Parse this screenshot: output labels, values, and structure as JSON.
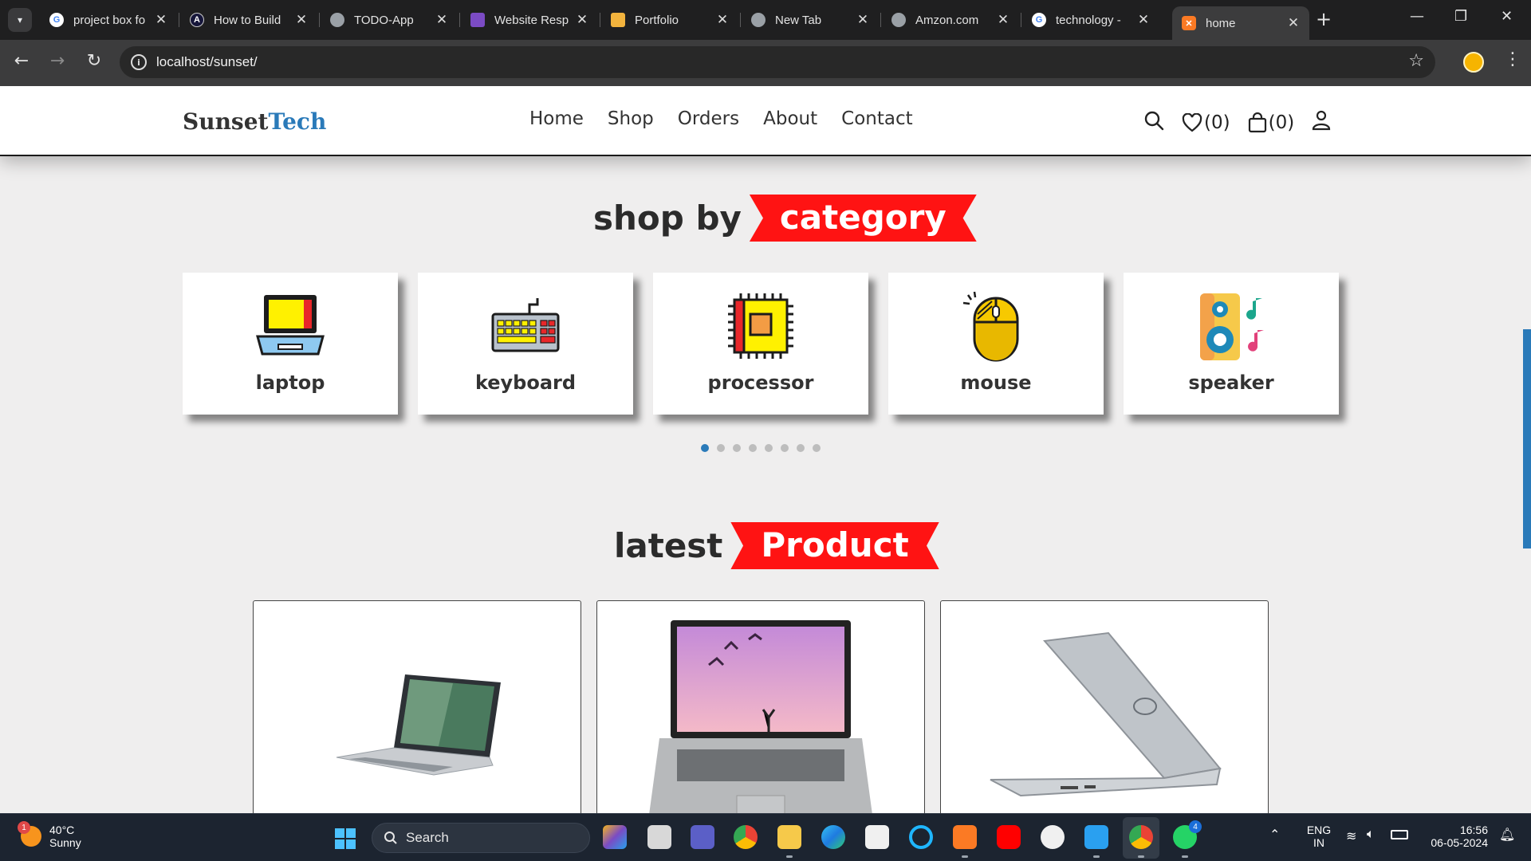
{
  "browser": {
    "tabs": [
      {
        "title": "project box fo",
        "favicon": "google-icon"
      },
      {
        "title": "How to Build",
        "favicon": "app-icon"
      },
      {
        "title": "TODO-App",
        "favicon": "globe-icon"
      },
      {
        "title": "Website Resp",
        "favicon": "website-icon"
      },
      {
        "title": "Portfolio",
        "favicon": "portfolio-icon"
      },
      {
        "title": "New Tab",
        "favicon": "chrome-icon"
      },
      {
        "title": "Amzon.com",
        "favicon": "globe-icon"
      },
      {
        "title": "technology -",
        "favicon": "google-icon"
      },
      {
        "title": "home",
        "favicon": "xampp-icon",
        "active": true
      }
    ],
    "url": "localhost/sunset/"
  },
  "site": {
    "logo_main": "Sunset",
    "logo_accent": "Tech",
    "nav": [
      "Home",
      "Shop",
      "Orders",
      "About",
      "Contact"
    ],
    "wishlist_count": "(0)",
    "cart_count": "(0)"
  },
  "category_section": {
    "title_plain": "shop by",
    "title_highlight": "category",
    "categories": [
      "laptop",
      "keyboard",
      "processor",
      "mouse",
      "speaker"
    ],
    "dots_total": 8,
    "dot_active_index": 0
  },
  "products_section": {
    "title_plain": "latest",
    "title_highlight": "Product"
  },
  "colors": {
    "accent_blue": "#2a7ab9",
    "ribbon_red": "#ff1313"
  },
  "taskbar": {
    "weather_temp": "40°C",
    "weather_desc": "Sunny",
    "weather_badge": "1",
    "search_label": "Search",
    "language": "ENG",
    "region": "IN",
    "time": "16:56",
    "date": "06-05-2024",
    "whatsapp_badge": "4"
  }
}
